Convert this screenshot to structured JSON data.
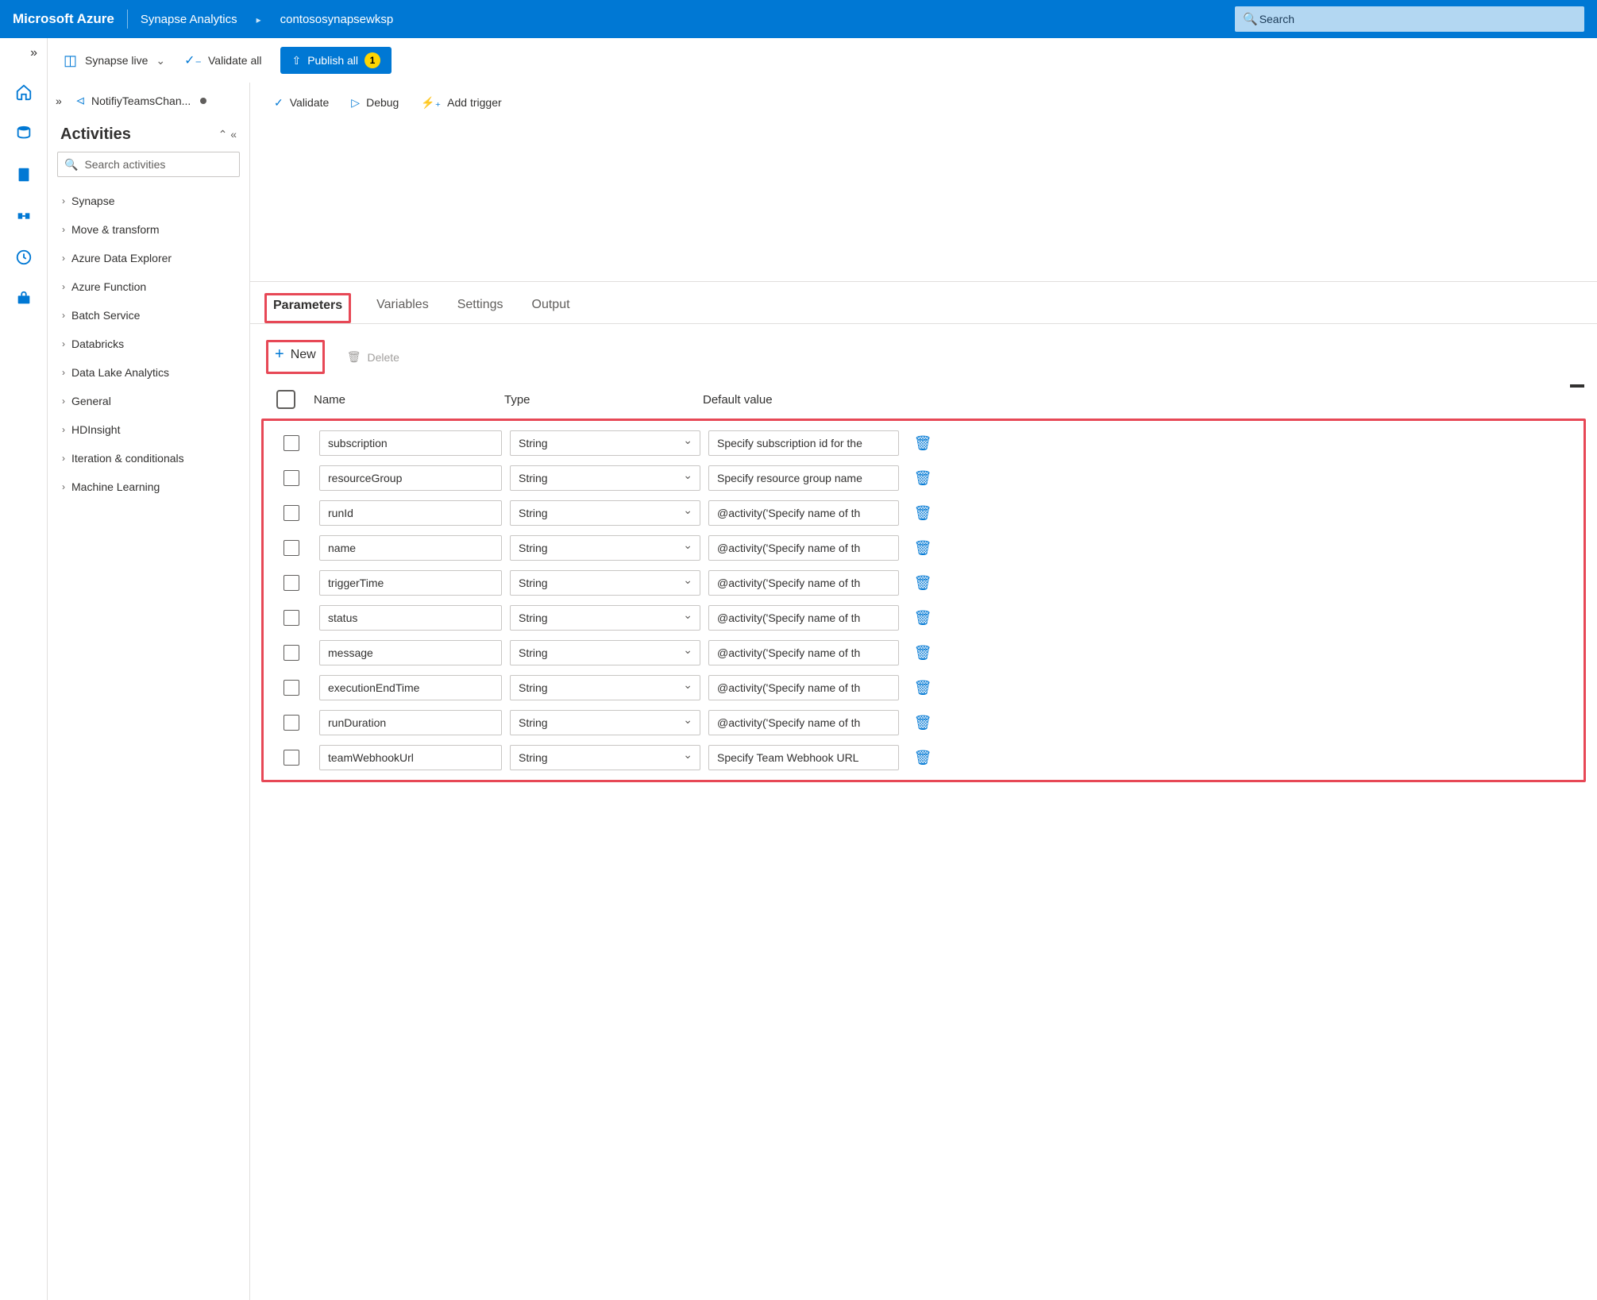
{
  "header": {
    "brand": "Microsoft Azure",
    "breadcrumb": [
      "Synapse Analytics",
      "contososynapsewksp"
    ],
    "search_placeholder": "Search"
  },
  "command_bar": {
    "synapse_live_label": "Synapse live",
    "validate_all_label": "Validate all",
    "publish_all_label": "Publish all",
    "publish_badge": "1"
  },
  "pipeline_tab": {
    "name": "NotifiyTeamsChan..."
  },
  "canvas_toolbar": {
    "validate": "Validate",
    "debug": "Debug",
    "add_trigger": "Add trigger"
  },
  "activities": {
    "title": "Activities",
    "search_placeholder": "Search activities",
    "groups": [
      "Synapse",
      "Move & transform",
      "Azure Data Explorer",
      "Azure Function",
      "Batch Service",
      "Databricks",
      "Data Lake Analytics",
      "General",
      "HDInsight",
      "Iteration & conditionals",
      "Machine Learning"
    ]
  },
  "bottom_panel": {
    "tabs": {
      "parameters": "Parameters",
      "variables": "Variables",
      "settings": "Settings",
      "output": "Output"
    },
    "toolbar": {
      "new_label": "New",
      "delete_label": "Delete"
    },
    "columns": {
      "name": "Name",
      "type": "Type",
      "default": "Default value"
    },
    "rows": [
      {
        "name": "subscription",
        "type": "String",
        "default": "Specify subscription id for the"
      },
      {
        "name": "resourceGroup",
        "type": "String",
        "default": "Specify resource group name"
      },
      {
        "name": "runId",
        "type": "String",
        "default": "@activity('Specify name of th"
      },
      {
        "name": "name",
        "type": "String",
        "default": "@activity('Specify name of th"
      },
      {
        "name": "triggerTime",
        "type": "String",
        "default": "@activity('Specify name of th"
      },
      {
        "name": "status",
        "type": "String",
        "default": "@activity('Specify name of th"
      },
      {
        "name": "message",
        "type": "String",
        "default": "@activity('Specify name of th"
      },
      {
        "name": "executionEndTime",
        "type": "String",
        "default": "@activity('Specify name of th"
      },
      {
        "name": "runDuration",
        "type": "String",
        "default": "@activity('Specify name of th"
      },
      {
        "name": "teamWebhookUrl",
        "type": "String",
        "default": "Specify Team Webhook URL"
      }
    ]
  }
}
